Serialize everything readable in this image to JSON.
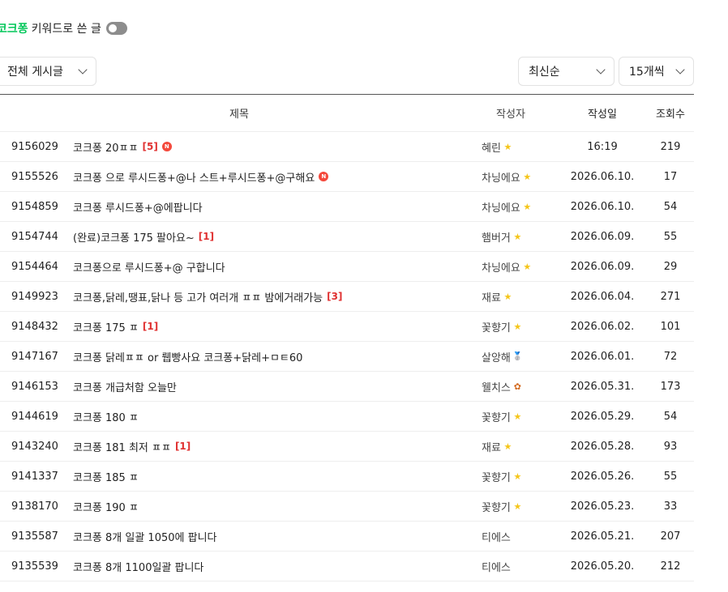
{
  "keyword_filter": {
    "keyword": "코크퐁",
    "label": "키워드로 쓴 글",
    "enabled": false
  },
  "filters": {
    "board": "전체 게시글",
    "sort": "최신순",
    "count": "15개씩"
  },
  "table": {
    "headers": {
      "title": "제목",
      "author": "작성자",
      "date": "작성일",
      "views": "조회수"
    },
    "rows": [
      {
        "no": "9156029",
        "title": "코크퐁 20ㅍㅍ",
        "comments": "[5]",
        "is_new": true,
        "author": "혜린",
        "level_icon": "star-icon",
        "date": "16:19",
        "views": "219"
      },
      {
        "no": "9155526",
        "title": "코크퐁 으로 루시드퐁+@나 스트+루시드퐁+@구해요",
        "comments": "",
        "is_new": true,
        "author": "차닝에요",
        "level_icon": "star-icon",
        "date": "2026.06.10.",
        "views": "17"
      },
      {
        "no": "9154859",
        "title": "코크퐁 루시드퐁+@에팝니다",
        "comments": "",
        "is_new": false,
        "author": "차닝에요",
        "level_icon": "star-icon",
        "date": "2026.06.10.",
        "views": "54"
      },
      {
        "no": "9154744",
        "title": "(완료)코크퐁 175 팔아요~",
        "comments": "[1]",
        "is_new": false,
        "author": "햄버거",
        "level_icon": "star-icon",
        "date": "2026.06.09.",
        "views": "55"
      },
      {
        "no": "9154464",
        "title": "코크퐁으로 루시드퐁+@ 구합니다",
        "comments": "",
        "is_new": false,
        "author": "차닝에요",
        "level_icon": "star-icon",
        "date": "2026.06.09.",
        "views": "29"
      },
      {
        "no": "9149923",
        "title": "코크퐁,닭레,땡표,닭나 등 고가 여러개 ㅍㅍ 밤에거래가능",
        "comments": "[3]",
        "is_new": false,
        "author": "재료",
        "level_icon": "star-icon",
        "date": "2026.06.04.",
        "views": "271"
      },
      {
        "no": "9148432",
        "title": "코크퐁 175 ㅍ",
        "comments": "[1]",
        "is_new": false,
        "author": "꽃향기",
        "level_icon": "star-icon",
        "date": "2026.06.02.",
        "views": "101"
      },
      {
        "no": "9147167",
        "title": "코크퐁 닭레ㅍㅍ or 뤱빵사요 코크퐁+닭레+ㅁㅌ60",
        "comments": "",
        "is_new": false,
        "author": "살앙해",
        "level_icon": "medal-icon",
        "date": "2026.06.01.",
        "views": "72"
      },
      {
        "no": "9146153",
        "title": "코크퐁 개급처함 오늘만",
        "comments": "",
        "is_new": false,
        "author": "웰치스",
        "level_icon": "flower-icon",
        "date": "2026.05.31.",
        "views": "173"
      },
      {
        "no": "9144619",
        "title": "코크퐁 180 ㅍ",
        "comments": "",
        "is_new": false,
        "author": "꽃향기",
        "level_icon": "star-icon",
        "date": "2026.05.29.",
        "views": "54"
      },
      {
        "no": "9143240",
        "title": "코크퐁 181 최저 ㅍㅍ",
        "comments": "[1]",
        "is_new": false,
        "author": "재료",
        "level_icon": "star-icon",
        "date": "2026.05.28.",
        "views": "93"
      },
      {
        "no": "9141337",
        "title": "코크퐁 185 ㅍ",
        "comments": "",
        "is_new": false,
        "author": "꽃향기",
        "level_icon": "star-icon",
        "date": "2026.05.26.",
        "views": "55"
      },
      {
        "no": "9138170",
        "title": "코크퐁 190 ㅍ",
        "comments": "",
        "is_new": false,
        "author": "꽃향기",
        "level_icon": "star-icon",
        "date": "2026.05.23.",
        "views": "33"
      },
      {
        "no": "9135587",
        "title": "코크퐁 8개 일괄 1050에 팝니다",
        "comments": "",
        "is_new": false,
        "author": "티에스",
        "level_icon": "",
        "date": "2026.05.21.",
        "views": "207"
      },
      {
        "no": "9135539",
        "title": "코크퐁 8개 1100일괄 팝니다",
        "comments": "",
        "is_new": false,
        "author": "티에스",
        "level_icon": "",
        "date": "2026.05.20.",
        "views": "212"
      }
    ]
  },
  "colors": {
    "keyword": "#03c75a",
    "comment_count": "#e03131",
    "new_badge": "#f4493c",
    "toggle_off": "#8d8d8d"
  },
  "new_badge_text": "N"
}
